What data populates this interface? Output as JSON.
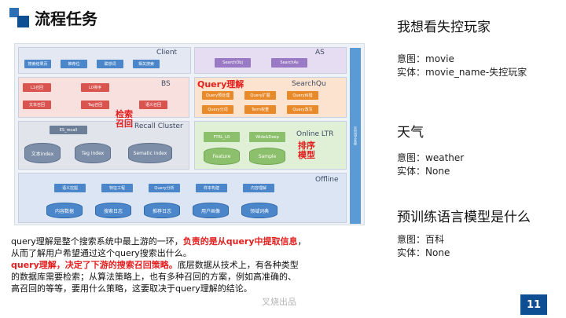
{
  "title": "流程任务",
  "paragraph": {
    "p1": "query理解是整个搜索系统中最上游的一环，",
    "p1_hl": "负责的是从query中提取信息",
    "p1_end": "，",
    "p2": "从而了解用户希望通过这个query搜索出什么。",
    "p3_hl": "query理解，决定了下游的搜索召回策略。",
    "p3": "底层数据从技术上，有各种类型",
    "p4": "的数据库需要检索；从算法策略上，也有多种召回的方案，例如高准确的、",
    "p5": "高召回的等等，要用什么策略，这要取决于query理解的结论。"
  },
  "watermark": "叉烧出品",
  "page_number": "11",
  "examples": [
    {
      "query": "我想看失控玩家",
      "intent_label": "意图：",
      "intent": "movie",
      "entity_label": "实体：",
      "entity": "movie_name-失控玩家"
    },
    {
      "query": "天气",
      "intent_label": "意图：",
      "intent": "weather",
      "entity_label": "实体：",
      "entity": "None"
    },
    {
      "query": "预训练语言模型是什么",
      "intent_label": "意图：",
      "intent": "百科",
      "entity_label": "实体：",
      "entity": "None"
    }
  ],
  "diagram": {
    "client": "Client",
    "as": "AS",
    "bs": "BS",
    "query_understand": "Query理解",
    "search_qu": "SearchQu",
    "recall_cluster": "Recall Cluster",
    "online_ltr": "Online LTR",
    "offline": "Offline",
    "recall_hint": "检索\n召回",
    "rank_hint": "排序\n模型",
    "es_recall": "ES_recall",
    "text_index": "文本index",
    "tag_index": "Tag index",
    "sematic_index": "Sematic index",
    "search_obj": "SearchObj",
    "search_as": "SearchAs",
    "ftrl_lr": "FTRL_LR",
    "wide_deep": "Wide&Deep",
    "feature": "Feature",
    "sample": "Sample",
    "client_boxes": [
      "搜索结果页",
      "推荐位",
      "联想词",
      "相关搜索"
    ],
    "bs_boxes": [
      "L1召回",
      "L0排序",
      "文本召回",
      "Tag召回",
      "语义召回"
    ],
    "qu_boxes": [
      "Query预处理",
      "Query扩展",
      "Query纠错",
      "Query分词",
      "Term权重",
      "Query改写"
    ],
    "offline_top": [
      "语义挖掘",
      "特征工程",
      "Query分析",
      "样本构建",
      "内容理解"
    ],
    "offline_bottom": [
      "内容数据",
      "搜索日志",
      "推荐日志",
      "用户画像",
      "领域词典"
    ],
    "side_text": "实时流式系统"
  },
  "colors": {
    "accent": "#0e4f93",
    "highlight": "#e31e1e"
  }
}
